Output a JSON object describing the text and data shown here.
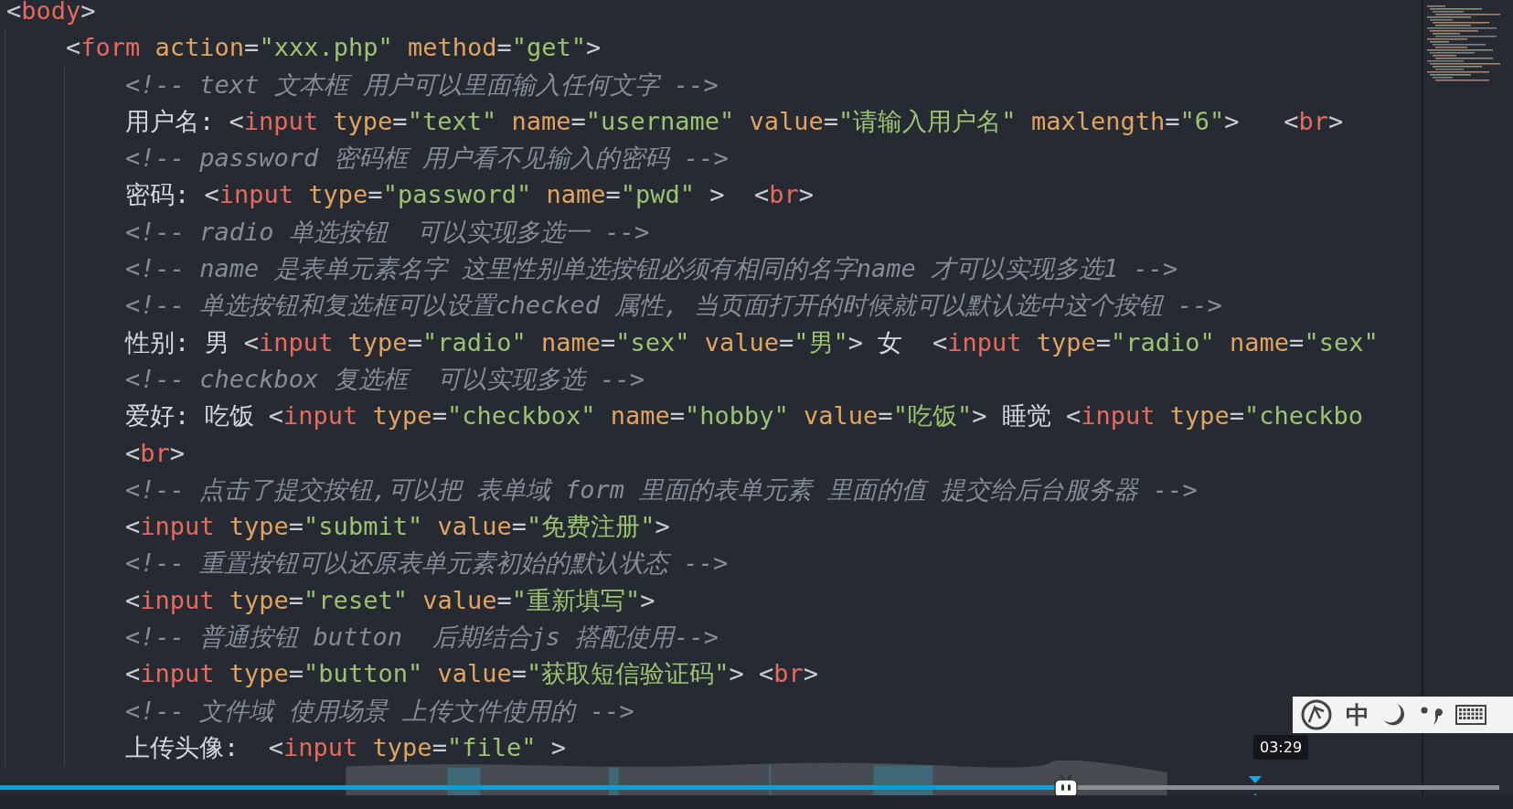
{
  "editor": {
    "lines": [
      {
        "kind": "code",
        "code": "<body>",
        "children": [
          {
            "kind": "code",
            "code": "<form action=\"xxx.php\" method=\"get\">",
            "children": [
              {
                "kind": "comment",
                "code": "<!-- text 文本框 用户可以里面输入任何文字 -->"
              },
              {
                "kind": "code",
                "code": "用户名: <input type=\"text\" name=\"username\" value=\"请输入用户名\" maxlength=\"6\">   <br>"
              },
              {
                "kind": "comment",
                "code": "<!-- password 密码框 用户看不见输入的密码 -->"
              },
              {
                "kind": "code",
                "code": "密码: <input type=\"password\" name=\"pwd\" >  <br>"
              },
              {
                "kind": "comment",
                "code": "<!-- radio 单选按钮  可以实现多选一 -->"
              },
              {
                "kind": "comment",
                "code": "<!-- name 是表单元素名字 这里性别单选按钮必须有相同的名字name 才可以实现多选1 -->"
              },
              {
                "kind": "comment",
                "code": "<!-- 单选按钮和复选框可以设置checked 属性, 当页面打开的时候就可以默认选中这个按钮 -->"
              },
              {
                "kind": "code",
                "code": "性别: 男 <input type=\"radio\" name=\"sex\" value=\"男\"> 女  <input type=\"radio\" name=\"sex\""
              },
              {
                "kind": "comment",
                "code": "<!-- checkbox 复选框  可以实现多选 -->"
              },
              {
                "kind": "code",
                "code": "爱好: 吃饭 <input type=\"checkbox\" name=\"hobby\" value=\"吃饭\"> 睡觉 <input type=\"checkbo"
              },
              {
                "kind": "code",
                "code": "<br>"
              },
              {
                "kind": "comment",
                "code": "<!-- 点击了提交按钮,可以把 表单域 form 里面的表单元素 里面的值 提交给后台服务器 -->"
              },
              {
                "kind": "code",
                "code": "<input type=\"submit\" value=\"免费注册\">"
              },
              {
                "kind": "comment",
                "code": "<!-- 重置按钮可以还原表单元素初始的默认状态 -->"
              },
              {
                "kind": "code",
                "code": "<input type=\"reset\" value=\"重新填写\">"
              },
              {
                "kind": "comment",
                "code": "<!-- 普通按钮 button  后期结合js 搭配使用-->"
              },
              {
                "kind": "code",
                "code": "<input type=\"button\" value=\"获取短信验证码\"> <br>"
              },
              {
                "kind": "comment",
                "code": "<!-- 文件域 使用场景 上传文件使用的 -->"
              },
              {
                "kind": "code",
                "code": "上传头像:  <input type=\"file\" >"
              }
            ]
          }
        ]
      }
    ]
  },
  "player": {
    "progress": {
      "level": 0.711
    },
    "hover_time": "03:29"
  },
  "ime_toolbar": {
    "mode": "中"
  }
}
